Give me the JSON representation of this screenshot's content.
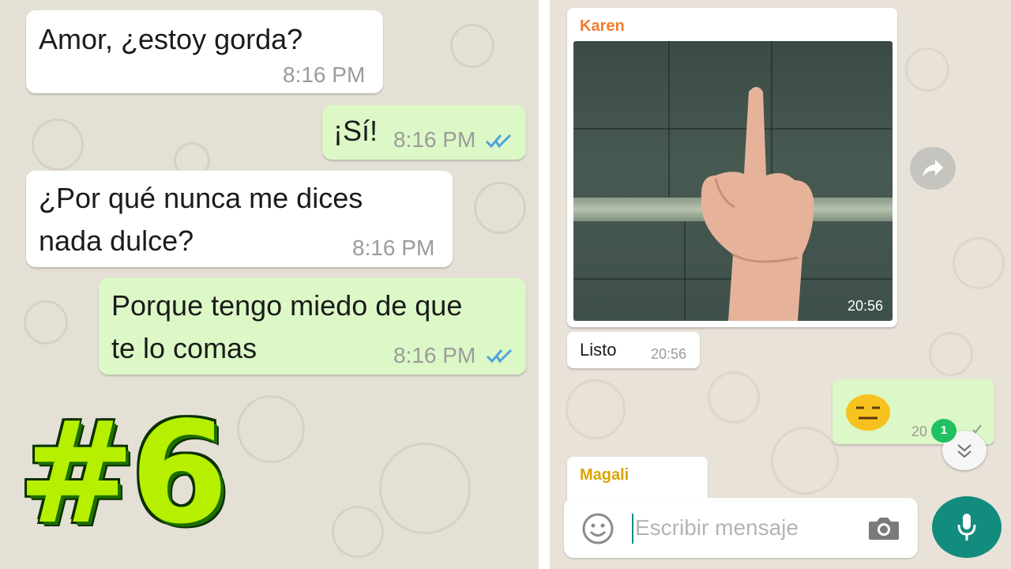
{
  "left_chat": {
    "messages": [
      {
        "text": "Amor, ¿estoy gorda?",
        "time": "8:16 PM"
      },
      {
        "text": "¡Sí!",
        "time": "8:16 PM"
      },
      {
        "line1": "¿Por qué nunca me dices",
        "line2": "nada dulce?",
        "time": "8:16 PM"
      },
      {
        "line1": "Porque tengo miedo de que",
        "line2": "te lo comas",
        "time": "8:16 PM"
      }
    ]
  },
  "episode_label": "#6",
  "right_chat": {
    "karen_name": "Karen",
    "photo_time": "20:56",
    "listo_text": "Listo",
    "listo_time": "20:56",
    "emoji_time_partial": "20",
    "unread_count": "1",
    "magali_name": "Magali",
    "input_placeholder": "Escribir mensaje"
  },
  "colors": {
    "incoming_bubble": "#ffffff",
    "outgoing_bubble": "#dcf8c6",
    "karen_name": "#f07c30",
    "magali_name": "#d9a400",
    "read_ticks": "#4fa3e0",
    "badge": "#21c063",
    "mic_button": "#128c7e",
    "episode_label": "#b6f000"
  },
  "icons": [
    "double-check-icon",
    "forward-icon",
    "chevron-double-down-icon",
    "emoji-icon",
    "camera-icon",
    "microphone-icon",
    "single-check-icon"
  ]
}
